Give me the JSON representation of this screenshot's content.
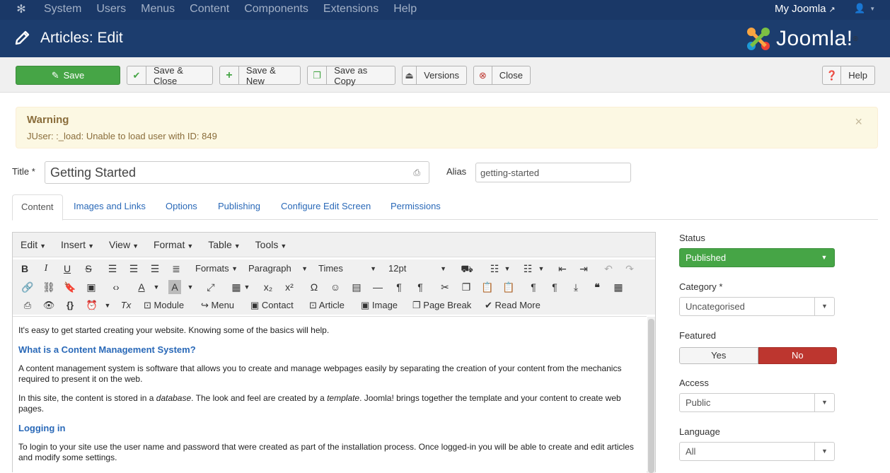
{
  "topnav": {
    "menu": [
      "System",
      "Users",
      "Menus",
      "Content",
      "Components",
      "Extensions",
      "Help"
    ],
    "site_link": "My Joomla"
  },
  "header": {
    "title": "Articles: Edit",
    "brand": "Joomla!"
  },
  "toolbar": {
    "save": "Save",
    "save_close": "Save & Close",
    "save_new": "Save & New",
    "save_copy": "Save as Copy",
    "versions": "Versions",
    "close": "Close",
    "help": "Help"
  },
  "alert": {
    "heading": "Warning",
    "message": "JUser: :_load: Unable to load user with ID: 849"
  },
  "form": {
    "title_label": "Title *",
    "title_value": "Getting Started",
    "alias_label": "Alias",
    "alias_value": "getting-started"
  },
  "tabs": [
    "Content",
    "Images and Links",
    "Options",
    "Publishing",
    "Configure Edit Screen",
    "Permissions"
  ],
  "editor": {
    "menus": [
      "Edit",
      "Insert",
      "View",
      "Format",
      "Table",
      "Tools"
    ],
    "formats": "Formats",
    "block": "Paragraph",
    "font": "Times",
    "size": "12pt",
    "buttons": {
      "module": "Module",
      "menu": "Menu",
      "contact": "Contact",
      "article": "Article",
      "image": "Image",
      "page_break": "Page Break",
      "read_more": "Read More"
    },
    "content": {
      "p1": "It's easy to get started creating your website. Knowing some of the basics will help.",
      "h1": "What is a Content Management System?",
      "p2": "A content management system is software that allows you to create and manage webpages easily by separating the creation of your content from the mechanics required to present it on the web.",
      "p3_a": "In this site, the content is stored in a ",
      "p3_em1": "database",
      "p3_b": ". The look and feel are created by a ",
      "p3_em2": "template",
      "p3_c": ". Joomla! brings together the template and your content to create web pages.",
      "h2": "Logging in",
      "p4": "To login to your site use the user name and password that were created as part of the installation process. Once logged-in you will be able to create and edit articles and modify some settings."
    }
  },
  "sidebar": {
    "status_label": "Status",
    "status_value": "Published",
    "category_label": "Category *",
    "category_value": "Uncategorised",
    "featured_label": "Featured",
    "featured_yes": "Yes",
    "featured_no": "No",
    "access_label": "Access",
    "access_value": "Public",
    "language_label": "Language",
    "language_value": "All"
  },
  "colors": {
    "nav": "#1a3867",
    "header": "#1c3d6e",
    "success": "#46a546",
    "danger": "#bd362f",
    "link": "#2a69b8"
  }
}
